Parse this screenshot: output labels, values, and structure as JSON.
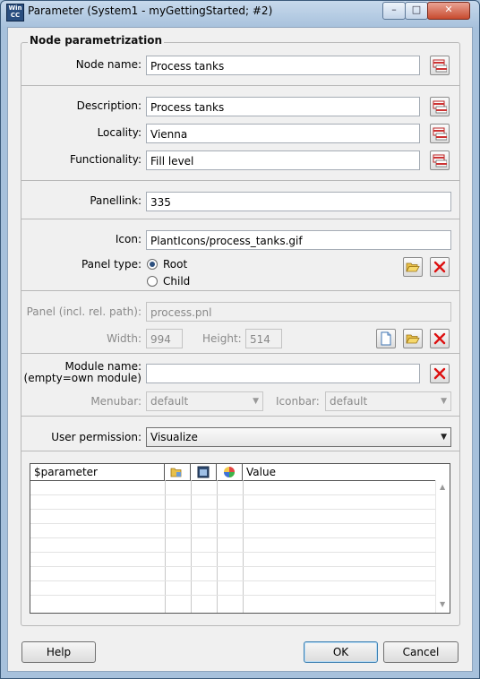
{
  "window": {
    "title": "Parameter (System1 - myGettingStarted; #2)",
    "icon_text": "WinCC OA"
  },
  "group": {
    "title": "Node parametrization"
  },
  "fields": {
    "node_name": {
      "label": "Node name:",
      "value": "Process tanks"
    },
    "description": {
      "label": "Description:",
      "value": "Process tanks"
    },
    "locality": {
      "label": "Locality:",
      "value": "Vienna"
    },
    "functionality": {
      "label": "Functionality:",
      "value": "Fill level"
    },
    "panellink": {
      "label": "Panellink:",
      "value": "335"
    },
    "icon": {
      "label": "Icon:",
      "value": "PlantIcons/process_tanks.gif"
    },
    "panel_type": {
      "label": "Panel type:",
      "options": [
        "Root",
        "Child"
      ],
      "selected": "Root"
    },
    "panel": {
      "label": "Panel (incl. rel. path):",
      "value": "process.pnl"
    },
    "width": {
      "label": "Width:",
      "value": "994"
    },
    "height": {
      "label": "Height:",
      "value": "514"
    },
    "module_name": {
      "label_line1": "Module name:",
      "label_line2": "(empty=own module)",
      "value": ""
    },
    "menubar": {
      "label": "Menubar:",
      "value": "default"
    },
    "iconbar": {
      "label": "Iconbar:",
      "value": "default"
    },
    "user_permission": {
      "label": "User permission:",
      "value": "Visualize"
    }
  },
  "table": {
    "columns": [
      "$parameter",
      "",
      "",
      "",
      "Value"
    ],
    "column_icons": [
      "",
      "folder-icon",
      "panel-icon",
      "color-wheel-icon",
      ""
    ],
    "rows": []
  },
  "buttons": {
    "help": "Help",
    "ok": "OK",
    "cancel": "Cancel"
  },
  "icons": {
    "lang": "language-flag-icon",
    "folder": "folder-open-icon",
    "delete": "delete-x-icon",
    "new": "new-document-icon"
  }
}
